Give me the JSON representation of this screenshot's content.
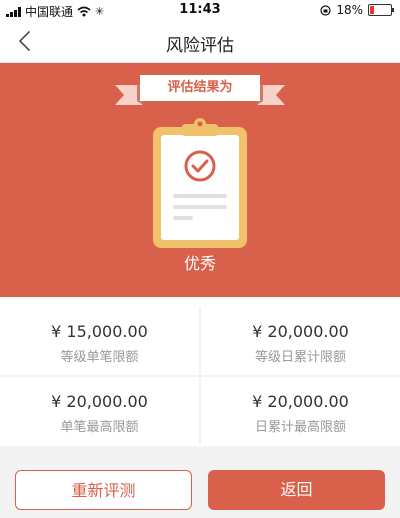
{
  "status_bar": {
    "carrier": "中国联通",
    "time": "11:43",
    "battery": "18%",
    "battery_level": 0.18
  },
  "nav": {
    "title": "风险评估",
    "back_icon": "chevron-left-icon"
  },
  "hero": {
    "banner": "评估结果为",
    "result": "优秀",
    "icon": "clipboard-check-icon",
    "colors": {
      "accent": "#d9604a",
      "clip": "#f2c16b"
    }
  },
  "limits": [
    {
      "amount": "¥ 15,000.00",
      "label": "等级单笔限额"
    },
    {
      "amount": "¥ 20,000.00",
      "label": "等级日累计限额"
    },
    {
      "amount": "¥ 20,000.00",
      "label": "单笔最高限额"
    },
    {
      "amount": "¥ 20,000.00",
      "label": "日累计最高限额"
    }
  ],
  "buttons": {
    "retest": "重新评测",
    "back": "返回"
  }
}
